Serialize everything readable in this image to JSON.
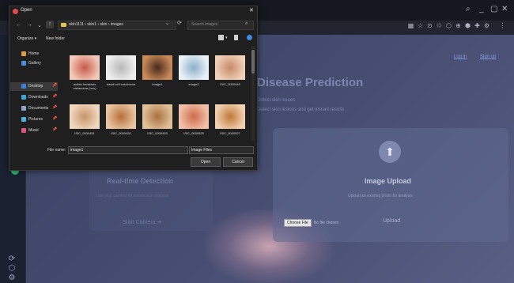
{
  "app": {
    "window_controls": {
      "search": "⌕",
      "minimize": "_",
      "maximize": "▢",
      "close": "✕"
    },
    "tab_icons": [
      "▦",
      "☆",
      "⊙",
      "♲",
      "⬡",
      "⊕",
      "⬢",
      "✚",
      "⚙",
      "⋮"
    ],
    "sidebar_icons": [
      "⟳",
      "⬡",
      "⚙"
    ],
    "nav": {
      "login": "Log in",
      "signup": "Sign up"
    },
    "title": "Disease Prediction",
    "subtitle1": "Detect skin issues",
    "subtitle2": "Detect skin lesions and get instant results",
    "realtime": {
      "title": "Real-time Detection",
      "description": "Use your camera for instant skin analysis",
      "start_label": "Start Camera  ➔"
    },
    "upload": {
      "icon": "⬆",
      "title": "Image Upload",
      "description": "Upload an existing photo for analysis",
      "choose_file": "Choose File",
      "no_file": "No file chosen",
      "button": "Upload"
    }
  },
  "dialog": {
    "title": "Open",
    "close": "✕",
    "nav_buttons": {
      "back": "←",
      "forward": "→",
      "dropdown": "⌄",
      "up": "↑"
    },
    "address": "skin1111  ›  skin1  ›  skin  ›  images",
    "address_dropdown": "⌄",
    "refresh": "⟳",
    "search_placeholder": "Search images",
    "search_icon": "⌕",
    "toolbar": {
      "organize": "Organize ▾",
      "new_folder": "New folder",
      "view_drop": "▾"
    },
    "nav_items": [
      {
        "label": "Home",
        "color": "#e29a3c",
        "pin": ""
      },
      {
        "label": "Gallery",
        "color": "#4b8fe0",
        "pin": ""
      },
      {
        "label": "Desktop",
        "color": "#3d7ed8",
        "pin": "📌"
      },
      {
        "label": "Downloads",
        "color": "#3fa7d8",
        "pin": "📌"
      },
      {
        "label": "Documents",
        "color": "#8fa4c8",
        "pin": "📌"
      },
      {
        "label": "Pictures",
        "color": "#4fb0e0",
        "pin": "📌"
      },
      {
        "label": "Music",
        "color": "#e0567a",
        "pin": "📌"
      }
    ],
    "files": [
      {
        "name": "actinic keratosis melanoma (mm)",
        "color1": "#c85a4a",
        "color2": "#f2c8b8"
      },
      {
        "name": "basal cell carcinoma",
        "color1": "#b8b8b8",
        "color2": "#eeeeee"
      },
      {
        "name": "image1",
        "color1": "#4a2a1a",
        "color2": "#c88a5a"
      },
      {
        "name": "image2",
        "color1": "#8ab0c8",
        "color2": "#eaf2f8"
      },
      {
        "name": "ISIC_0000449",
        "color1": "#c88a6a",
        "color2": "#f0d0b8"
      },
      {
        "name": "ISIC_0000451",
        "color1": "#c8946a",
        "color2": "#f0d8c0"
      },
      {
        "name": "ISIC_0000452",
        "color1": "#b8703a",
        "color2": "#e8c4a0"
      },
      {
        "name": "ISIC_0000453",
        "color1": "#a87040",
        "color2": "#e0c098"
      },
      {
        "name": "ISIC_0000525",
        "color1": "#d06a4a",
        "color2": "#f0c0a8"
      },
      {
        "name": "ISIC_0000527",
        "color1": "#c07838",
        "color2": "#f0d0b0"
      }
    ],
    "file_name_label": "File name:",
    "file_name_value": "image1",
    "file_type": "Image Files",
    "open_label": "Open",
    "cancel_label": "Cancel",
    "resize_grip": "⋰"
  }
}
